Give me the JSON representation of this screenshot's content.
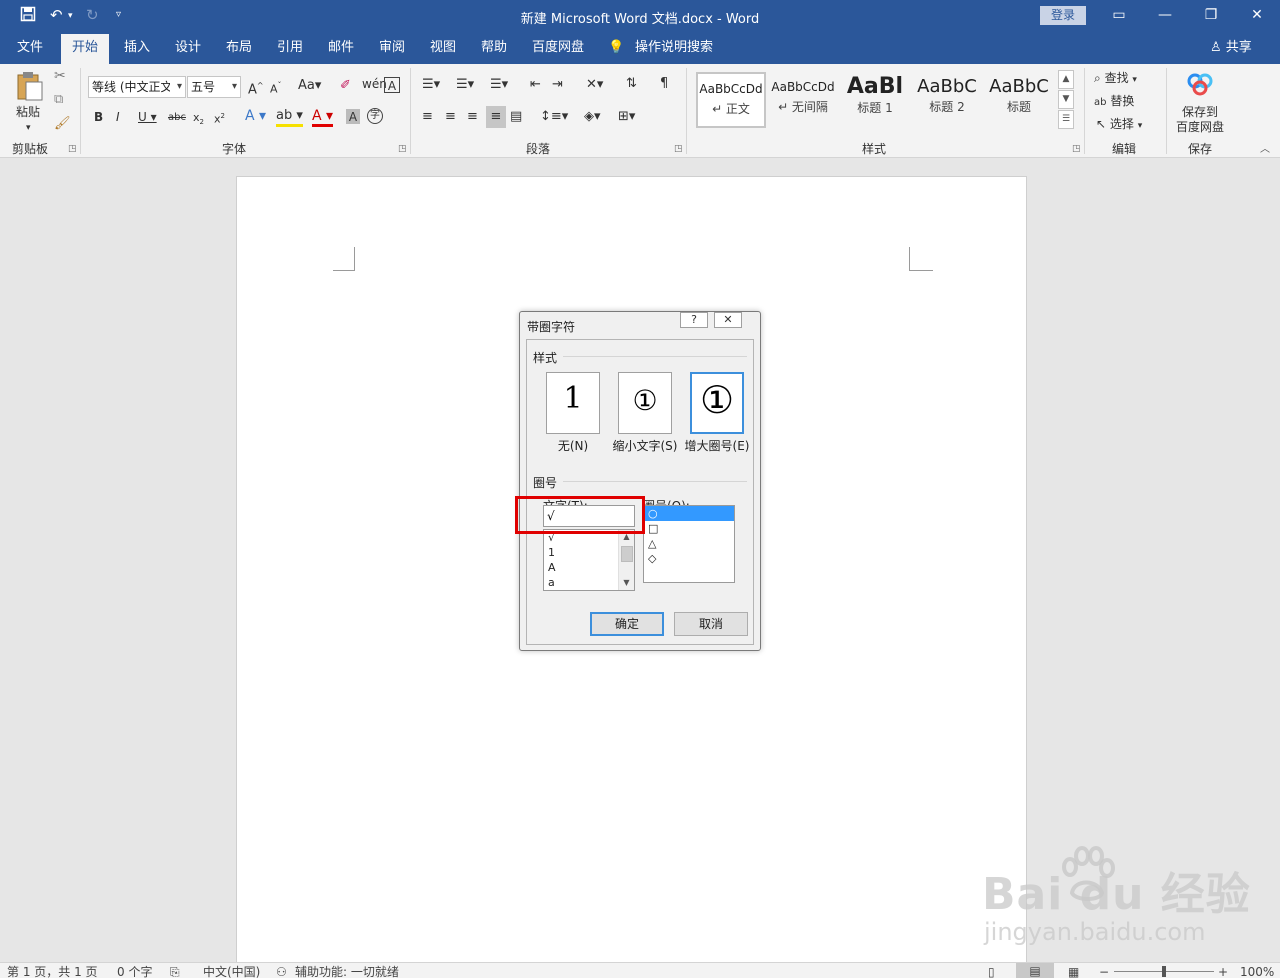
{
  "window": {
    "title": "新建 Microsoft Word 文档.docx  -  Word",
    "login_label": "登录"
  },
  "tabs": [
    "文件",
    "开始",
    "插入",
    "设计",
    "布局",
    "引用",
    "邮件",
    "审阅",
    "视图",
    "帮助",
    "百度网盘"
  ],
  "tell_me": "操作说明搜索",
  "share_label": "共享",
  "ribbon": {
    "clipboard": {
      "paste_label": "粘贴",
      "group_label": "剪贴板"
    },
    "font": {
      "font_name": "等线 (中文正文)",
      "font_size": "五号",
      "group_label": "字体"
    },
    "paragraph": {
      "group_label": "段落"
    },
    "styles": {
      "group_label": "样式",
      "items": [
        {
          "sample": "AaBbCcDd",
          "name": "↵ 正文"
        },
        {
          "sample": "AaBbCcDd",
          "name": "↵ 无间隔"
        },
        {
          "sample": "AaBl",
          "name": "标题 1"
        },
        {
          "sample": "AaBbC",
          "name": "标题 2"
        },
        {
          "sample": "AaBbC",
          "name": "标题"
        }
      ]
    },
    "editing": {
      "find": "查找",
      "replace": "替换",
      "select": "选择",
      "group_label": "编辑"
    },
    "save": {
      "label_line1": "保存到",
      "label_line2": "百度网盘",
      "group_label": "保存"
    }
  },
  "dialog": {
    "title": "带圈字符",
    "help_label": "?",
    "close_label": "✕",
    "style_section": "样式",
    "style_options": [
      {
        "glyph": "1",
        "label": "无(N)"
      },
      {
        "glyph": "①",
        "label": "缩小文字(S)"
      },
      {
        "glyph": "①",
        "label": "增大圈号(E)"
      }
    ],
    "circle_section": "圈号",
    "text_label": "文字(T):",
    "circle_label": "圈号(O):",
    "text_value": "√",
    "text_list": [
      "√",
      "1",
      "A",
      "a"
    ],
    "circle_list": [
      "○",
      "□",
      "△",
      "◇"
    ],
    "ok_label": "确定",
    "cancel_label": "取消"
  },
  "statusbar": {
    "page": "第 1 页，共 1 页",
    "words": "0 个字",
    "language": "中文(中国)",
    "accessibility": "辅助功能: 一切就绪",
    "zoom": "100%"
  },
  "watermark": {
    "logo": "Bai du 经验",
    "url": "jingyan.baidu.com"
  },
  "colors": {
    "brand": "#2b579a",
    "highlight": "#e00000",
    "selection": "#3399ff"
  }
}
